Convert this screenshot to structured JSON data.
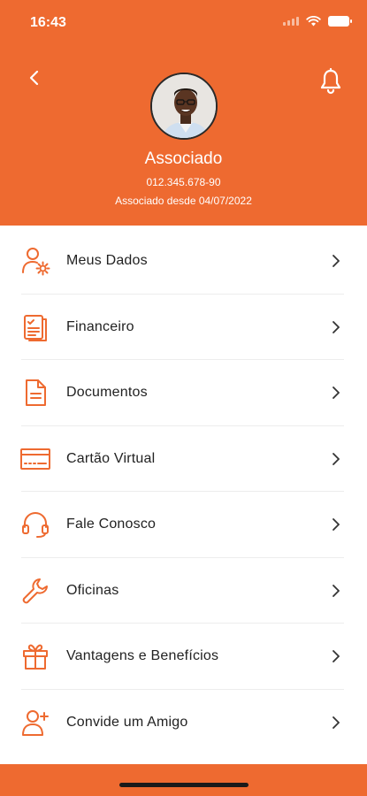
{
  "status_bar": {
    "time": "16:43"
  },
  "profile": {
    "name": "Associado",
    "id_number": "012.345.678-90",
    "member_since": "Associado desde 04/07/2022"
  },
  "icons": {
    "back": "chevron-left-icon",
    "notifications": "bell-icon"
  },
  "menu": {
    "items": [
      {
        "label": "Meus Dados",
        "icon": "user-settings-icon"
      },
      {
        "label": "Financeiro",
        "icon": "clipboard-check-icon"
      },
      {
        "label": "Documentos",
        "icon": "document-icon"
      },
      {
        "label": "Cartão Virtual",
        "icon": "card-icon"
      },
      {
        "label": "Fale Conosco",
        "icon": "headset-icon"
      },
      {
        "label": "Oficinas",
        "icon": "wrench-icon"
      },
      {
        "label": "Vantagens e Benefícios",
        "icon": "gift-icon"
      },
      {
        "label": "Convide um Amigo",
        "icon": "user-plus-icon"
      }
    ]
  },
  "colors": {
    "brand": "#ee6a30",
    "text": "#222222",
    "divider": "#ededed"
  }
}
